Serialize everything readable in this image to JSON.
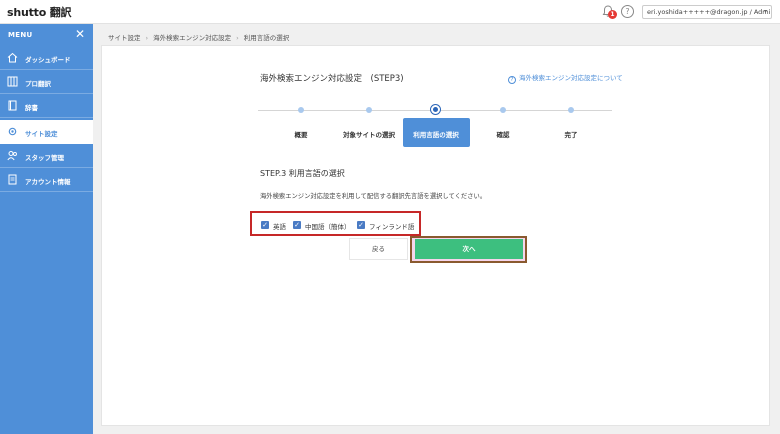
{
  "header": {
    "logo": "shutto 翻訳",
    "notification_count": "1",
    "help": "?",
    "user": "eri.yoshida+++++@dragon.jp / Admin"
  },
  "sidebar": {
    "menu_label": "MENU",
    "items": [
      {
        "label": "ダッシュボード",
        "icon": "home-icon"
      },
      {
        "label": "プロ翻訳",
        "icon": "columns-icon"
      },
      {
        "label": "辞書",
        "icon": "book-icon"
      },
      {
        "label": "サイト設定",
        "icon": "gear-icon",
        "active": true
      },
      {
        "label": "スタッフ管理",
        "icon": "users-icon"
      },
      {
        "label": "アカウント情報",
        "icon": "document-icon"
      }
    ]
  },
  "breadcrumb": [
    "サイト設定",
    "海外検索エンジン対応設定",
    "利用言語の選択"
  ],
  "main": {
    "title": "海外検索エンジン対応設定　(STEP3)",
    "help_link": "海外検索エンジン対応設定について",
    "steps": [
      "概要",
      "対象サイトの選択",
      "利用言語の選択",
      "確認",
      "完了"
    ],
    "active_step": 2,
    "section_title": "STEP.3 利用言語の選択",
    "description": "海外検索エンジン対応設定を利用して配信する翻訳先言語を選択してください。",
    "languages": [
      {
        "label": "英語",
        "checked": true
      },
      {
        "label": "中国語（簡体）",
        "checked": true
      },
      {
        "label": "フィンランド語",
        "checked": true
      }
    ],
    "back_label": "戻る",
    "next_label": "次へ"
  },
  "colors": {
    "sidebar": "#4f8fd8",
    "next_button": "#3dbf7f",
    "highlight": "#c62828"
  }
}
